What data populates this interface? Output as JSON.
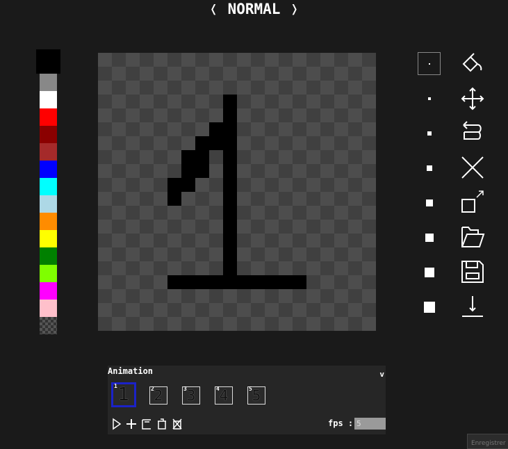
{
  "header": {
    "prev_symbol": "❬",
    "mode_label": "NORMAL",
    "next_symbol": "❭"
  },
  "palette": {
    "current": "#000000",
    "colors": [
      "#888888",
      "#ffffff",
      "#ff0000",
      "#8b0000",
      "#a52a2a",
      "#0000ff",
      "#00ffff",
      "#add8e6",
      "#ff8c00",
      "#ffff00",
      "#008000",
      "#7fff00",
      "#ff00ff",
      "#ffc0cb",
      "transparent"
    ]
  },
  "canvas": {
    "grid_size": 20,
    "background_light": "#4d4d4d",
    "background_dark": "#404040",
    "ink": "#000000",
    "pixels": [
      [
        9,
        3
      ],
      [
        9,
        4
      ],
      [
        8,
        5
      ],
      [
        9,
        5
      ],
      [
        7,
        6
      ],
      [
        8,
        6
      ],
      [
        9,
        6
      ],
      [
        6,
        7
      ],
      [
        7,
        7
      ],
      [
        9,
        7
      ],
      [
        6,
        8
      ],
      [
        7,
        8
      ],
      [
        9,
        8
      ],
      [
        5,
        9
      ],
      [
        6,
        9
      ],
      [
        9,
        9
      ],
      [
        9,
        10
      ],
      [
        5,
        10
      ],
      [
        9,
        11
      ],
      [
        9,
        12
      ],
      [
        9,
        13
      ],
      [
        9,
        14
      ],
      [
        9,
        15
      ],
      [
        9,
        16
      ],
      [
        5,
        16
      ],
      [
        6,
        16
      ],
      [
        7,
        16
      ],
      [
        8,
        16
      ],
      [
        10,
        16
      ],
      [
        11,
        16
      ],
      [
        12,
        16
      ],
      [
        13,
        16
      ],
      [
        14,
        16
      ]
    ]
  },
  "brush_sizes": [
    1,
    2,
    3,
    4,
    5,
    6,
    7,
    8
  ],
  "brush_selected_index": 0,
  "tools": [
    "fill-bucket-icon",
    "move-icon",
    "undo-icon",
    "clear-icon",
    "resize-icon",
    "open-folder-icon",
    "save-icon",
    "download-icon"
  ],
  "animation": {
    "title": "Animation",
    "collapse_symbol": "v",
    "frames": [
      {
        "number": "1",
        "thumb": "1"
      },
      {
        "number": "2",
        "thumb": "2"
      },
      {
        "number": "3",
        "thumb": "3"
      },
      {
        "number": "4",
        "thumb": "4"
      },
      {
        "number": "5",
        "thumb": "5"
      }
    ],
    "active_frame": 0,
    "controls": [
      "play-icon",
      "add-frame-icon",
      "duplicate-frame-icon",
      "delete-frame-icon",
      "clear-frames-icon"
    ],
    "fps_label": "fps :",
    "fps_value": "5"
  },
  "record_button": {
    "label": "Enregistrer"
  }
}
